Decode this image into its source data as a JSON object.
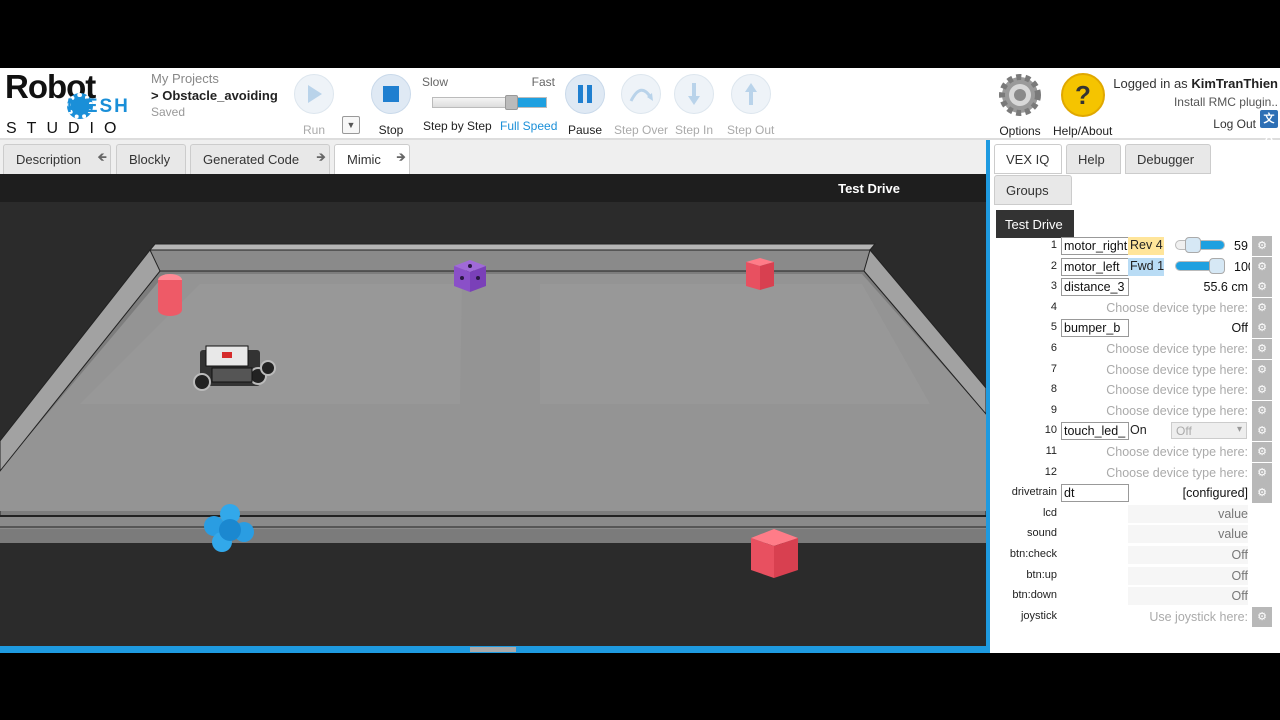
{
  "logo": {
    "robot": "Robot",
    "mesh": "MESH",
    "studio": "STUDIO"
  },
  "project": {
    "my_projects": "My Projects",
    "name": "> Obstacle_avoiding",
    "status": "Saved"
  },
  "toolbar": {
    "run": "Run",
    "stop": "Stop",
    "step_by_step": "Step by Step",
    "full_speed": "Full Speed",
    "pause": "Pause",
    "step_over": "Step Over",
    "step_in": "Step In",
    "step_out": "Step Out",
    "slow": "Slow",
    "fast": "Fast",
    "speed_level": 0.64,
    "options": "Options",
    "help_about": "Help/About"
  },
  "user": {
    "logged_in_prefix": "Logged in as ",
    "username": "KimTranThien",
    "install_plugin": "Install RMC plugin..",
    "logout": "Log Out",
    "translate_icon": "文A"
  },
  "tabs": [
    "Description",
    "Blockly",
    "Generated Code",
    "Mimic"
  ],
  "viewport": {
    "title": "Test Drive"
  },
  "panel": {
    "tabs": [
      "VEX IQ",
      "Help",
      "Debugger",
      "Groups"
    ],
    "section": "Test Drive",
    "choose": "Choose device type here:",
    "ports": [
      {
        "idx": "1",
        "name": "motor_right",
        "status": "Rev 4",
        "level": 0.35,
        "num": "59"
      },
      {
        "idx": "2",
        "name": "motor_left",
        "status": "Fwd 1",
        "level": 0.85,
        "num": "100"
      },
      {
        "idx": "3",
        "name": "distance_3",
        "value": "55.6 cm"
      },
      {
        "idx": "4"
      },
      {
        "idx": "5",
        "name": "bumper_b",
        "value": "Off"
      },
      {
        "idx": "6"
      },
      {
        "idx": "7"
      },
      {
        "idx": "8"
      },
      {
        "idx": "9"
      },
      {
        "idx": "10",
        "name": "touch_led_",
        "status": "On",
        "select": "Off"
      },
      {
        "idx": "11"
      },
      {
        "idx": "12"
      }
    ],
    "drivetrain": {
      "label": "drivetrain",
      "name": "dt",
      "value": "[configured]"
    },
    "extras": [
      {
        "label": "lcd",
        "value": "value"
      },
      {
        "label": "sound",
        "value": "value"
      },
      {
        "label": "btn:check",
        "value": "Off"
      },
      {
        "label": "btn:up",
        "value": "Off"
      },
      {
        "label": "btn:down",
        "value": "Off"
      }
    ],
    "joystick": {
      "label": "joystick",
      "value": "Use joystick here:"
    }
  }
}
